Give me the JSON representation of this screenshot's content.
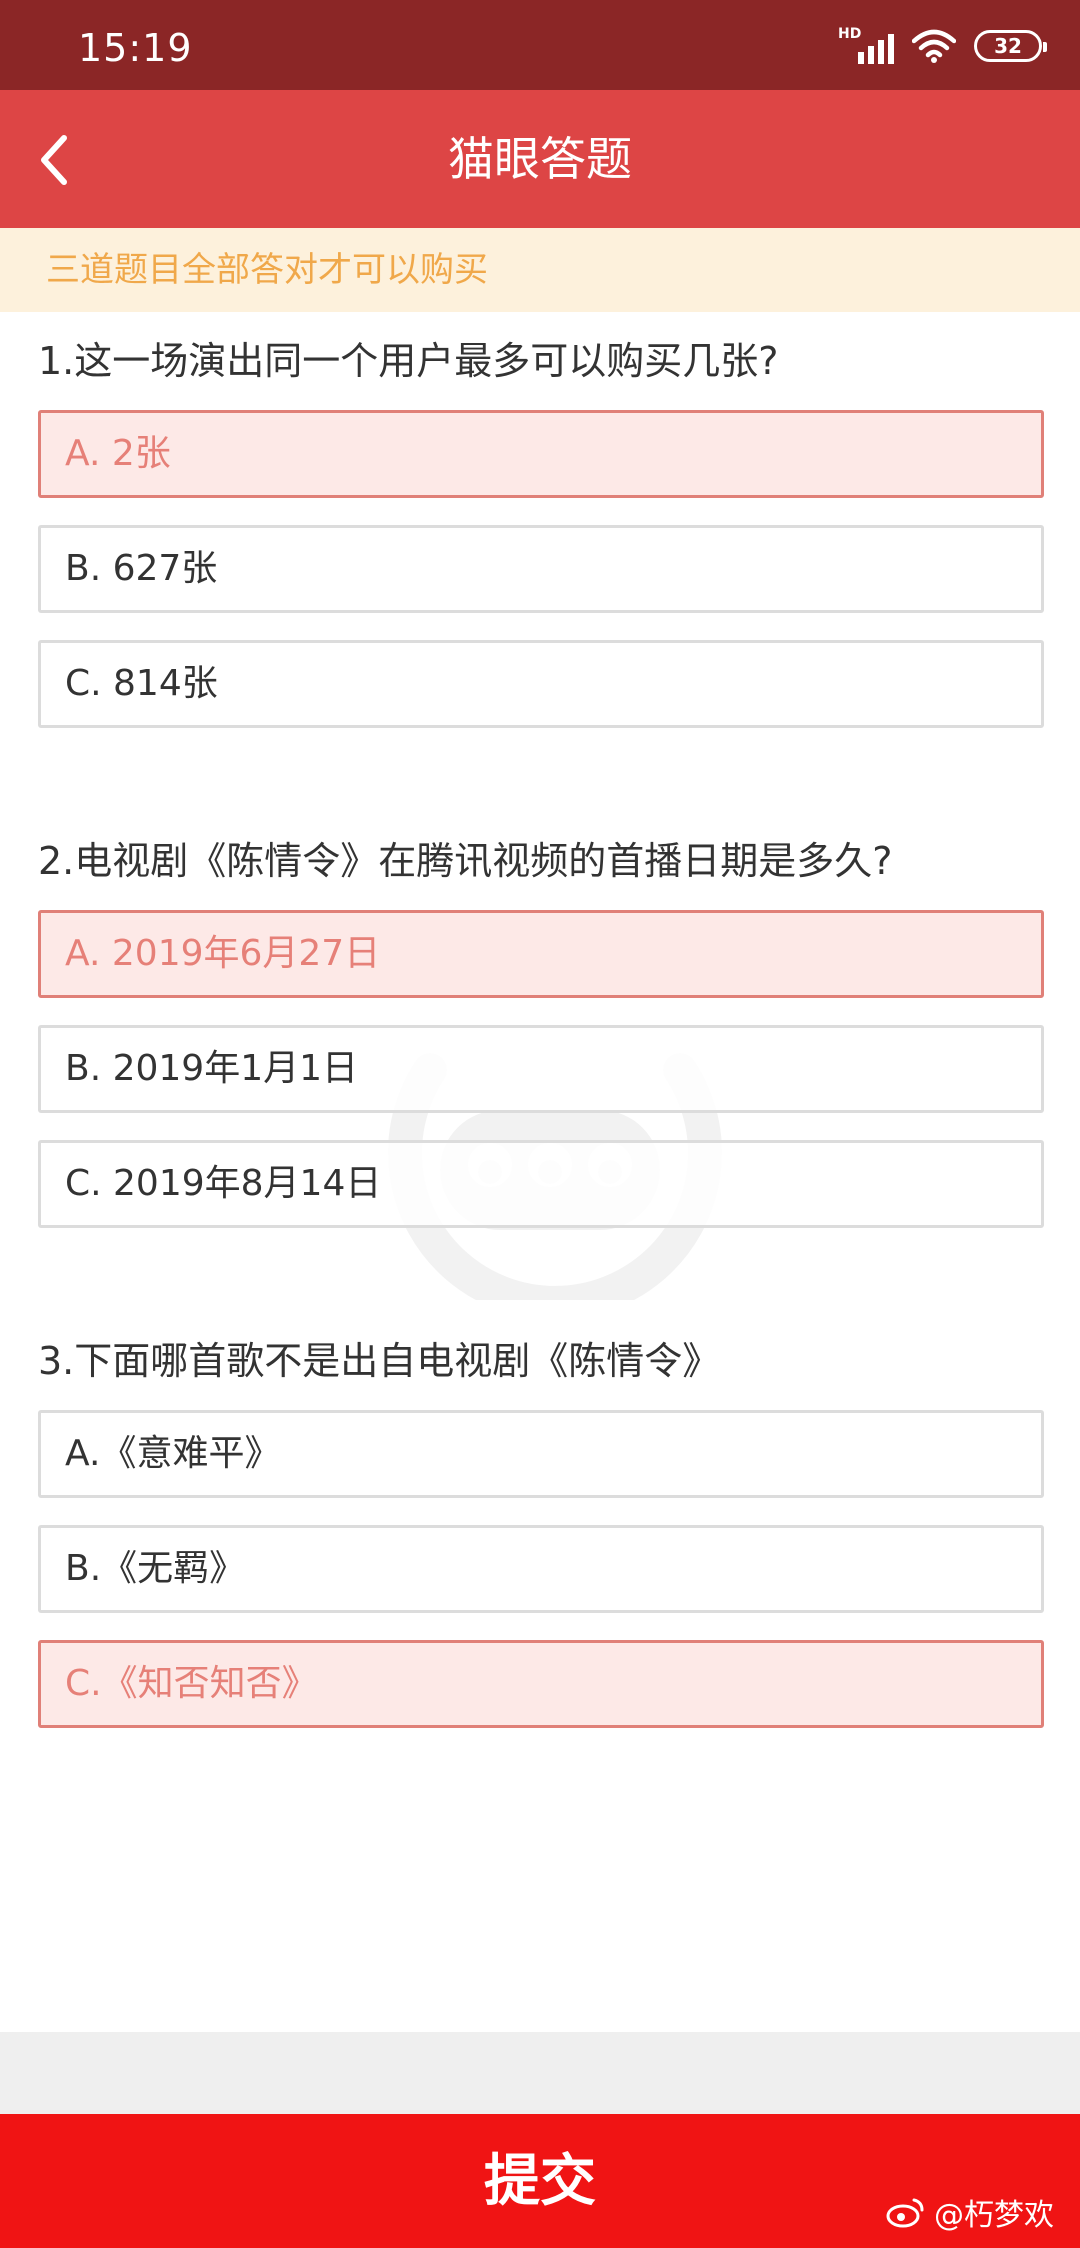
{
  "status": {
    "time": "15:19",
    "network": "HD",
    "battery": "32"
  },
  "nav": {
    "title": "猫眼答题",
    "back_icon": "chevron-left-icon"
  },
  "notice": "三道题目全部答对才可以购买",
  "questions": [
    {
      "title": "1.这一场演出同一个用户最多可以购买几张?",
      "options": [
        {
          "label": "A. 2张",
          "selected": true
        },
        {
          "label": "B. 627张",
          "selected": false
        },
        {
          "label": "C. 814张",
          "selected": false
        }
      ]
    },
    {
      "title": "2.电视剧《陈情令》在腾讯视频的首播日期是多久?",
      "options": [
        {
          "label": "A. 2019年6月27日",
          "selected": true
        },
        {
          "label": "B. 2019年1月1日",
          "selected": false
        },
        {
          "label": "C. 2019年8月14日",
          "selected": false
        }
      ]
    },
    {
      "title": "3.下面哪首歌不是出自电视剧《陈情令》",
      "options": [
        {
          "label": "A.《意难平》",
          "selected": false
        },
        {
          "label": "B.《无羁》",
          "selected": false
        },
        {
          "label": "C.《知否知否》",
          "selected": true
        }
      ]
    }
  ],
  "submit_label": "提交",
  "credit": "@朽梦欢",
  "colors": {
    "status_bar": "#8b2626",
    "nav_bar": "#dd4545",
    "notice_bg": "#fdf1dc",
    "notice_text": "#f0a84a",
    "selected_border": "#e08078",
    "selected_bg": "#fde9e7",
    "submit": "#f01414"
  }
}
